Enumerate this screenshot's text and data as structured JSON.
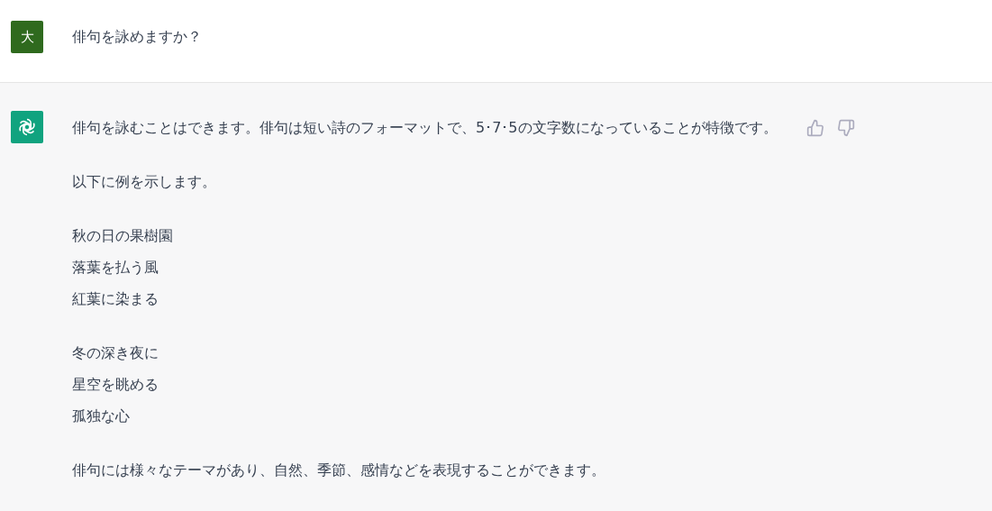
{
  "user_message": {
    "avatar": "大",
    "text": "俳句を詠めますか？"
  },
  "assistant_message": {
    "paragraphs": [
      {
        "lines": [
          "俳句を詠むことはできます。俳句は短い詩のフォーマットで、5･7･5の文字数になっていることが特徴です。"
        ]
      },
      {
        "lines": [
          "以下に例を示します。"
        ]
      },
      {
        "lines": [
          "秋の日の果樹園",
          "落葉を払う風",
          "紅葉に染まる"
        ]
      },
      {
        "lines": [
          "冬の深き夜に",
          "星空を眺める",
          "孤独な心"
        ]
      },
      {
        "lines": [
          "俳句には様々なテーマがあり、自然、季節、感情などを表現することができます。"
        ]
      }
    ]
  }
}
